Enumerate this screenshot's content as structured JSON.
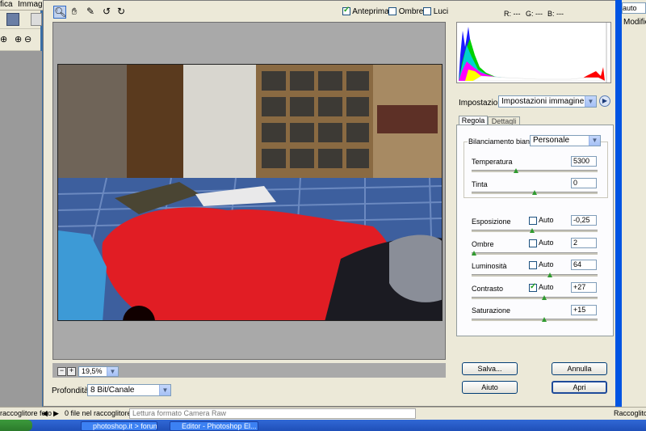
{
  "ps": {
    "menu": {
      "item1": "fica",
      "item2": "Immagi"
    },
    "right_field_top": "auto",
    "right_label": "Modific",
    "status": {
      "left": "raccoglitore foto",
      "count": "0 file nel raccoglitore",
      "field": "Lettura formato Camera Raw",
      "right": "Raccoglitore"
    },
    "taskbar": {
      "task1": "photoshop.it > forum f...",
      "task2": "Editor - Photoshop El..."
    }
  },
  "toolbar": {
    "anteprima": "Anteprima",
    "ombre": "Ombre",
    "luci": "Luci",
    "rgb": {
      "r": "R: ---",
      "g": "G: ---",
      "b": "B: ---"
    }
  },
  "zoom": {
    "value": "19,5%"
  },
  "profondita": {
    "label": "Profondità:",
    "value": "8 Bit/Canale"
  },
  "impostazioni": {
    "label": "Impostazioni:",
    "value": "Impostazioni immagine"
  },
  "tabs": {
    "regola": "Regola",
    "dettagli": "Dettagli"
  },
  "wb": {
    "label": "Bilanciamento bianco:",
    "value": "Personale"
  },
  "sliders": {
    "temperatura": {
      "label": "Temperatura",
      "value": "5300",
      "level": 0.35
    },
    "tinta": {
      "label": "Tinta",
      "value": "0",
      "level": 0.5
    },
    "esposizione": {
      "label": "Esposizione",
      "value": "-0,25",
      "level": 0.48
    },
    "ombre": {
      "label": "Ombre",
      "value": "2",
      "level": 0.02
    },
    "luminosita": {
      "label": "Luminosità",
      "value": "64",
      "level": 0.62
    },
    "contrasto": {
      "label": "Contrasto",
      "value": "+27",
      "level": 0.58
    },
    "saturazione": {
      "label": "Saturazione",
      "value": "+15",
      "level": 0.58
    }
  },
  "auto_label": "Auto",
  "buttons": {
    "salva": "Salva...",
    "aiuto": "Aiuto",
    "annulla": "Annulla",
    "apri": "Apri"
  },
  "colors": {
    "accent": "#0054e3",
    "slider_thumb": "#2f9a2f",
    "histogram_red": "#ff0000"
  }
}
